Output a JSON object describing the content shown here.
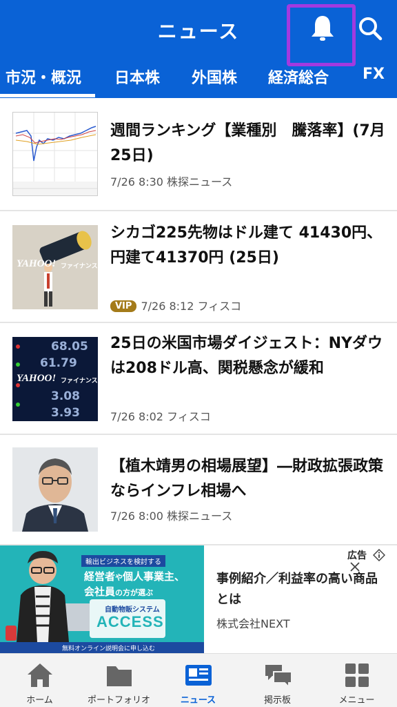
{
  "header": {
    "title": "ニュース",
    "icons": {
      "notification": "bell-icon",
      "search": "search-icon"
    },
    "tabs": [
      {
        "label": "市況・概況",
        "active": true
      },
      {
        "label": "日本株",
        "active": false
      },
      {
        "label": "外国株",
        "active": false
      },
      {
        "label": "経済総合",
        "active": false
      },
      {
        "label": "FX",
        "active": false
      }
    ]
  },
  "news": [
    {
      "title": "週間ランキング【業種別　騰落率】(7月25日)",
      "meta": "7/26 8:30 株探ニュース",
      "vip": false
    },
    {
      "title": "シカゴ225先物はドル建て 41430円、円建て41370円 (25日)",
      "meta": "7/26 8:12 フィスコ",
      "vip": true,
      "vip_label": "VIP"
    },
    {
      "title": "25日の米国市場ダイジェスト：NYダウは208ドル高、関税懸念が緩和",
      "meta": "7/26 8:02 フィスコ",
      "vip": false
    },
    {
      "title": "【植木靖男の相場展望】―財政拡張政策ならインフレ相場へ",
      "meta": "7/26 8:00 株探ニュース",
      "vip": false
    }
  ],
  "thumb_texts": {
    "yahoo_logo": "YAHOO!",
    "yahoo_sub": "ファイナンス",
    "numbers": [
      "68.05",
      "61.79",
      "3.08",
      "3.93"
    ]
  },
  "ad": {
    "label": "広告",
    "title": "事例紹介／利益率の高い商品とは",
    "sponsor": "株式会社NEXT",
    "banner": {
      "top": "輸出ビジネスを検討する",
      "line1": "経営者",
      "mid": "や",
      "line2": "個人事業主、",
      "line3": "会社員",
      "line4": "の方が選ぶ",
      "system": "自動物販システム",
      "brand": "ACCESS",
      "bottom": "無料オンライン説明会に申し込む"
    }
  },
  "tabbar": [
    {
      "label": "ホーム",
      "icon": "home-icon",
      "active": false
    },
    {
      "label": "ポートフォリオ",
      "icon": "folder-icon",
      "active": false
    },
    {
      "label": "ニュース",
      "icon": "newspaper-icon",
      "active": true
    },
    {
      "label": "掲示板",
      "icon": "chat-bubbles-icon",
      "active": false
    },
    {
      "label": "メニュー",
      "icon": "grid-menu-icon",
      "active": false
    }
  ],
  "colors": {
    "brand_blue": "#0a62d6",
    "highlight_purple": "#a23ae0",
    "vip_gold": "#a47b1a"
  }
}
